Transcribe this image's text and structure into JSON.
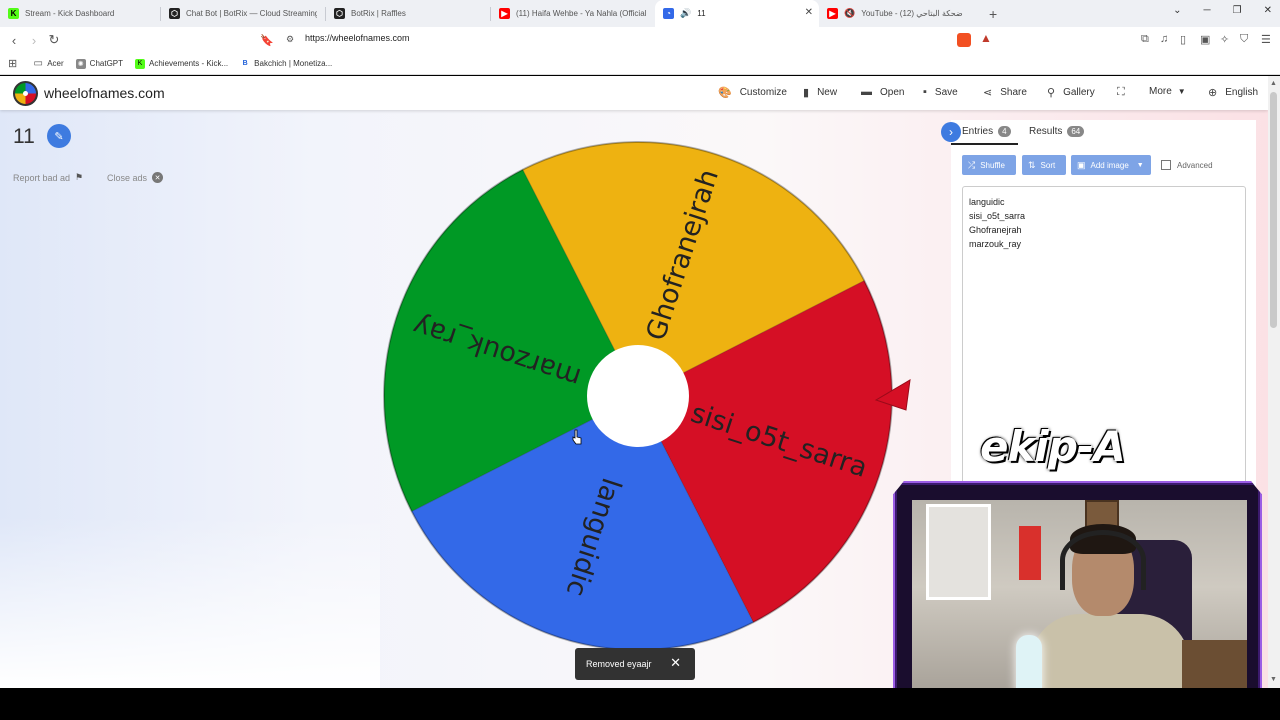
{
  "browser": {
    "tabs": [
      {
        "title": "Stream - Kick Dashboard",
        "favicon_color": "#53fc18",
        "favicon_glyph": "K",
        "active": false
      },
      {
        "title": "Chat Bot | BotRix — Cloud Streaming",
        "favicon_color": "#222222",
        "favicon_glyph": "⬡",
        "active": false
      },
      {
        "title": "BotRix | Raffles",
        "favicon_color": "#222222",
        "favicon_glyph": "⬡",
        "active": false
      },
      {
        "title": "(11) Haifa Wehbe - Ya Nahla (Official",
        "favicon_color": "#ff0000",
        "favicon_glyph": "▶",
        "active": false
      },
      {
        "title": "11",
        "favicon_color": "#3369e8",
        "favicon_glyph": "◔",
        "active": true
      },
      {
        "title": "YouTube - ضحكة البتاحي (12)",
        "favicon_color": "#ff0000",
        "favicon_glyph": "▶",
        "active": false
      }
    ],
    "new_tab_label": "+",
    "url": "https://wheelofnames.com",
    "bookmarks": [
      {
        "label": "Acer",
        "icon": "folder-icon"
      },
      {
        "label": "ChatGPT",
        "icon": "chatgpt-icon"
      },
      {
        "label": "Achievements - Kick...",
        "icon": "kick-icon"
      },
      {
        "label": "Bakchich | Monetiza...",
        "icon": "bakchich-icon"
      }
    ]
  },
  "app": {
    "brand": "wheelofnames.com",
    "menu": [
      {
        "label": "Customize",
        "icon": "palette-icon"
      },
      {
        "label": "New",
        "icon": "file-icon"
      },
      {
        "label": "Open",
        "icon": "folder-open-icon"
      },
      {
        "label": "Save",
        "icon": "floppy-icon"
      },
      {
        "label": "Share",
        "icon": "share-icon"
      },
      {
        "label": "Gallery",
        "icon": "search-icon"
      },
      {
        "label": "",
        "icon": "fullscreen-icon"
      },
      {
        "label": "More",
        "icon": "chevron-down-icon"
      },
      {
        "label": "English",
        "icon": "globe-icon"
      }
    ],
    "wheel_title": "11",
    "report_ad": "Report bad ad",
    "close_ads": "Close ads"
  },
  "wheel": {
    "segments": [
      {
        "name": "Ghofranejrah",
        "color": "#eeb211"
      },
      {
        "name": "sisi_o5t_sarra",
        "color": "#d50f25"
      },
      {
        "name": "languidic",
        "color": "#3369e8"
      },
      {
        "name": "marzouk_ray",
        "color": "#009925"
      }
    ],
    "pointer_color": "#d50f25"
  },
  "panel": {
    "tabs": [
      {
        "label": "Entries",
        "count": "4"
      },
      {
        "label": "Results",
        "count": "64"
      }
    ],
    "buttons": {
      "shuffle": "Shuffle",
      "sort": "Sort",
      "add_image": "Add image"
    },
    "advanced_label": "Advanced",
    "entries": [
      "languidic",
      "sisi_o5t_sarra",
      "Ghofranejrah",
      "marzouk_ray"
    ]
  },
  "toast": {
    "message": "Removed eyaajr"
  },
  "overlay": {
    "logo_text": "ekip-A"
  }
}
